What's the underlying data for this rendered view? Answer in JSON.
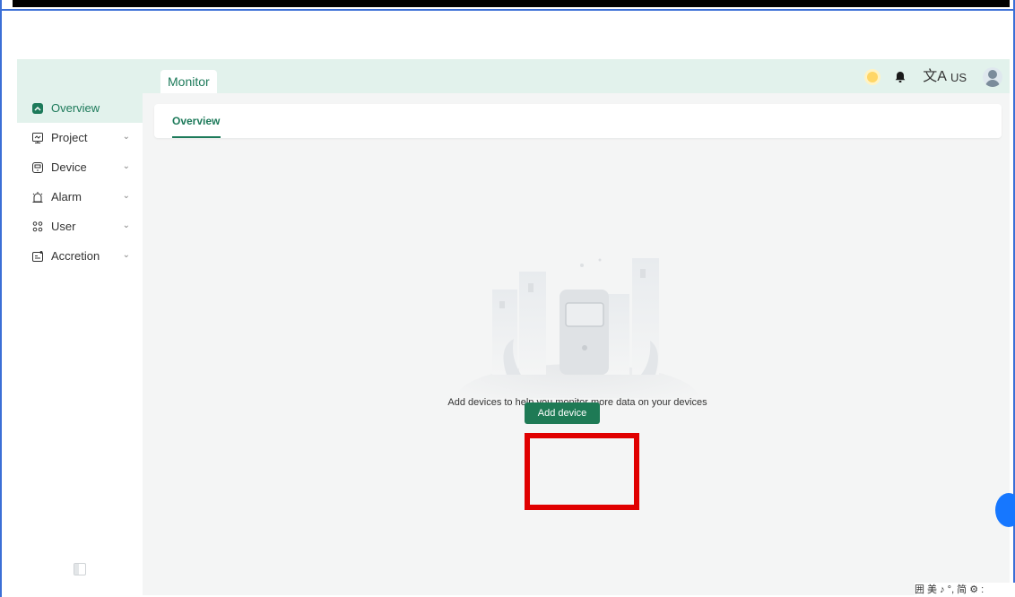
{
  "window": {
    "accent_color": "#1d7a5a",
    "header_color": "#e2f2ec",
    "frame_color": "#3b6fd6"
  },
  "header": {
    "tab_label": "Monitor",
    "language_code": "US",
    "language_glyph": "文A",
    "icons": [
      "theme-sun-icon",
      "notification-bell-icon",
      "language-icon",
      "user-avatar"
    ]
  },
  "sidebar": {
    "items": [
      {
        "label": "Overview",
        "icon": "overview-icon",
        "active": true
      },
      {
        "label": "Project",
        "icon": "project-icon",
        "has_chevron": true
      },
      {
        "label": "Device",
        "icon": "device-icon",
        "has_chevron": true
      },
      {
        "label": "Alarm",
        "icon": "alarm-icon",
        "has_chevron": true
      },
      {
        "label": "User",
        "icon": "user-group-icon",
        "has_chevron": true
      },
      {
        "label": "Accretion",
        "icon": "accretion-icon",
        "has_chevron": true
      }
    ],
    "chevron_glyph": "⌄"
  },
  "main": {
    "tab": "Overview",
    "empty_message": "Add devices to help you monitor more data on your devices",
    "add_button_label": "Add device",
    "highlight_color": "#e00000"
  },
  "ime_bar": {
    "text": "囲 美 ♪ °, 简 ⚙ :"
  }
}
